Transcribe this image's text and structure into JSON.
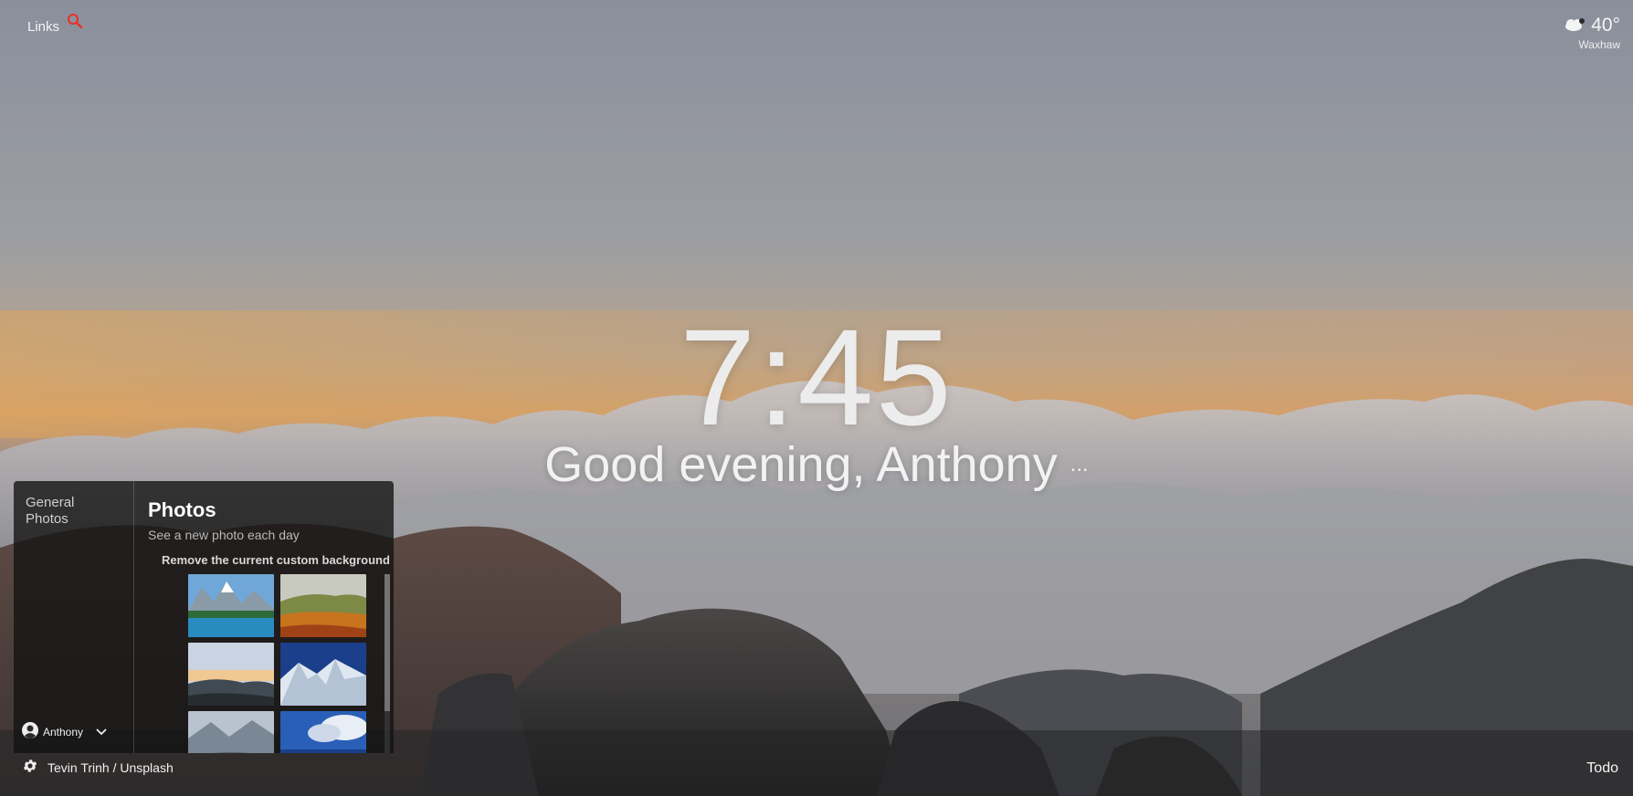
{
  "top_left": {
    "links_label": "Links",
    "search_icon": "search-icon"
  },
  "weather": {
    "icon": "cloud-moon-icon",
    "temperature": "40°",
    "location": "Waxhaw"
  },
  "clock": {
    "time": "7:45"
  },
  "greeting": {
    "text": "Good evening, Anthony",
    "more": "..."
  },
  "settings": {
    "nav": [
      "General",
      "Photos"
    ],
    "user": {
      "name": "Anthony",
      "avatar_icon": "account-circle-icon",
      "dropdown_icon": "chevron-down-icon"
    },
    "photos": {
      "title": "Photos",
      "subtitle": "See a new photo each day",
      "remove_label": "Remove the current custom background",
      "thumbnails": [
        "mountain-lake",
        "autumn-valley",
        "sunset-coast",
        "snowy-peaks",
        "alpine-valley",
        "ocean-clouds"
      ]
    }
  },
  "footer": {
    "credit": "Tevin Trinh / Unsplash",
    "gear_icon": "gear-icon",
    "todo": "Todo"
  },
  "colors": {
    "accent_search": "#e8302a",
    "panel_bg": "#121212"
  }
}
